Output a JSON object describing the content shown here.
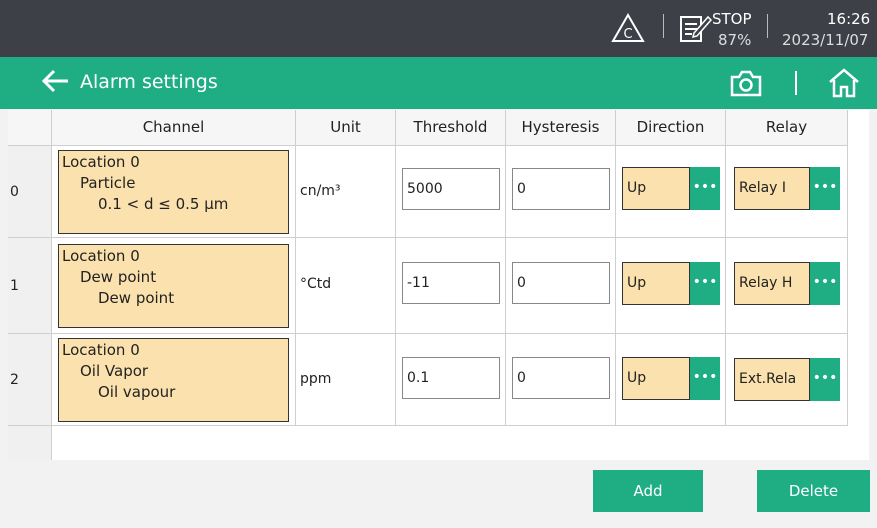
{
  "status": {
    "mode": "STOP",
    "percent": "87%",
    "time": "16:26",
    "date": "2023/11/07"
  },
  "header": {
    "title": "Alarm settings"
  },
  "columns": [
    "Channel",
    "Unit",
    "Threshold",
    "Hysteresis",
    "Direction",
    "Relay"
  ],
  "rows": [
    {
      "index": "0",
      "location": "Location 0",
      "group": "Particle",
      "detail": "0.1 < d ≤ 0.5 µm",
      "unit": "cn/m³",
      "threshold": "5000",
      "hysteresis": "0",
      "direction": "Up",
      "relay": "Relay I"
    },
    {
      "index": "1",
      "location": "Location 0",
      "group": "Dew point",
      "detail": "Dew point",
      "unit": "°Ctd",
      "threshold": "-11",
      "hysteresis": "0",
      "direction": "Up",
      "relay": "Relay H"
    },
    {
      "index": "2",
      "location": "Location 0",
      "group": "Oil Vapor",
      "detail": "Oil vapour",
      "unit": "ppm",
      "threshold": "0.1",
      "hysteresis": "0",
      "direction": "Up",
      "relay": "Ext.Rela"
    }
  ],
  "ellipsis": "•••",
  "buttons": {
    "add": "Add",
    "delete": "Delete"
  },
  "icons": {
    "alert": "warning-triangle-icon",
    "edit": "edit-document-icon",
    "camera": "camera-icon",
    "home": "home-icon",
    "back": "arrow-left-icon"
  },
  "colors": {
    "accent": "#1fae84",
    "channel_bg": "#fbe1ad",
    "statusbar_bg": "#3e4048"
  }
}
